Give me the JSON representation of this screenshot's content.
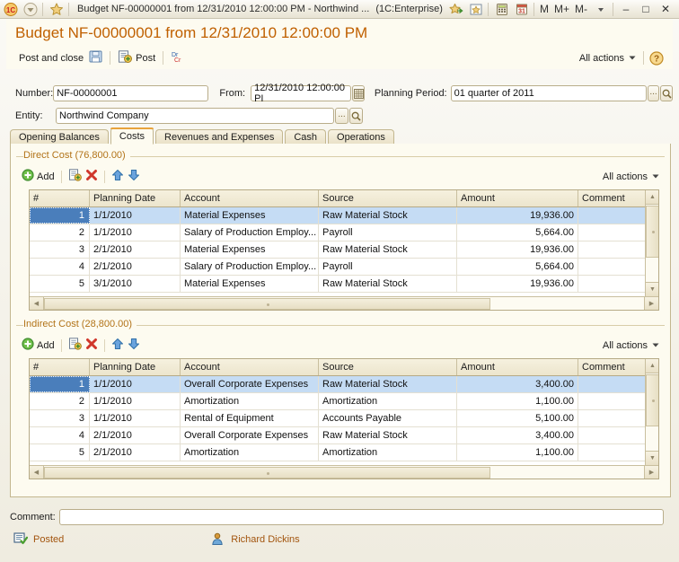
{
  "window": {
    "title": "Budget NF-00000001 from 12/31/2010 12:00:00 PM - Northwind ...",
    "app": "(1C:Enterprise)",
    "mem_m": "M",
    "mem_plus": "M+",
    "mem_minus": "M-",
    "minimize": "–",
    "maximize": "□",
    "close": "✕"
  },
  "header": {
    "title": "Budget NF-00000001 from 12/31/2010 12:00:00 PM"
  },
  "commandbar": {
    "post_and_close": "Post and close",
    "post": "Post",
    "dr_cr": "Dr/Cr",
    "all_actions": "All actions",
    "help": "?"
  },
  "fields": {
    "number_label": "Number:",
    "number_value": "NF-00000001",
    "from_label": "From:",
    "from_value": "12/31/2010 12:00:00 PI",
    "planning_period_label": "Planning Period:",
    "planning_period_value": "01 quarter of 2011",
    "entity_label": "Entity:",
    "entity_value": "Northwind Company",
    "dots": "...",
    "select_icon": "magnifier-icon"
  },
  "tabs": [
    {
      "label": "Opening Balances",
      "active": false
    },
    {
      "label": "Costs",
      "active": true
    },
    {
      "label": "Revenues and Expenses",
      "active": false
    },
    {
      "label": "Cash",
      "active": false
    },
    {
      "label": "Operations",
      "active": false
    }
  ],
  "sections": [
    {
      "title": "Direct Cost (76,800.00)",
      "toolbar": {
        "add": "Add",
        "copy": "copy-row-icon",
        "delete": "delete-row-icon",
        "move_up": "move-up-icon",
        "move_down": "move-down-icon",
        "all_actions": "All actions"
      },
      "columns": [
        "#",
        "Planning Date",
        "Account",
        "Source",
        "Amount",
        "Comment"
      ],
      "rows": [
        {
          "idx": "1",
          "date": "1/1/2010",
          "account": "Material Expenses",
          "source": "Raw Material Stock",
          "amount": "19,936.00",
          "comment": "",
          "selected": true
        },
        {
          "idx": "2",
          "date": "1/1/2010",
          "account": "Salary of Production Employ...",
          "source": "Payroll",
          "amount": "5,664.00",
          "comment": "",
          "selected": false
        },
        {
          "idx": "3",
          "date": "2/1/2010",
          "account": "Material Expenses",
          "source": "Raw Material Stock",
          "amount": "19,936.00",
          "comment": "",
          "selected": false
        },
        {
          "idx": "4",
          "date": "2/1/2010",
          "account": "Salary of Production Employ...",
          "source": "Payroll",
          "amount": "5,664.00",
          "comment": "",
          "selected": false
        },
        {
          "idx": "5",
          "date": "3/1/2010",
          "account": "Material Expenses",
          "source": "Raw Material Stock",
          "amount": "19,936.00",
          "comment": "",
          "selected": false
        }
      ]
    },
    {
      "title": "Indirect Cost (28,800.00)",
      "toolbar": {
        "add": "Add",
        "copy": "copy-row-icon",
        "delete": "delete-row-icon",
        "move_up": "move-up-icon",
        "move_down": "move-down-icon",
        "all_actions": "All actions"
      },
      "columns": [
        "#",
        "Planning Date",
        "Account",
        "Source",
        "Amount",
        "Comment"
      ],
      "rows": [
        {
          "idx": "1",
          "date": "1/1/2010",
          "account": "Overall Corporate Expenses",
          "source": "Raw Material Stock",
          "amount": "3,400.00",
          "comment": "",
          "selected": true
        },
        {
          "idx": "2",
          "date": "1/1/2010",
          "account": "Amortization",
          "source": "Amortization",
          "amount": "1,100.00",
          "comment": "",
          "selected": false
        },
        {
          "idx": "3",
          "date": "1/1/2010",
          "account": "Rental of Equipment",
          "source": "Accounts Payable",
          "amount": "5,100.00",
          "comment": "",
          "selected": false
        },
        {
          "idx": "4",
          "date": "2/1/2010",
          "account": "Overall Corporate Expenses",
          "source": "Raw Material Stock",
          "amount": "3,400.00",
          "comment": "",
          "selected": false
        },
        {
          "idx": "5",
          "date": "2/1/2010",
          "account": "Amortization",
          "source": "Amortization",
          "amount": "1,100.00",
          "comment": "",
          "selected": false
        }
      ]
    }
  ],
  "footer": {
    "comment_label": "Comment:",
    "comment_value": "",
    "status_text": "Posted",
    "status_icon": "posted-document-icon",
    "user_name": "Richard Dickins",
    "user_icon": "user-icon"
  },
  "colors": {
    "accent": "#c06000",
    "group_title": "#b27318",
    "status": "#a2540d",
    "selection": "#c5dcf4",
    "selection_index": "#4a7ebb"
  }
}
